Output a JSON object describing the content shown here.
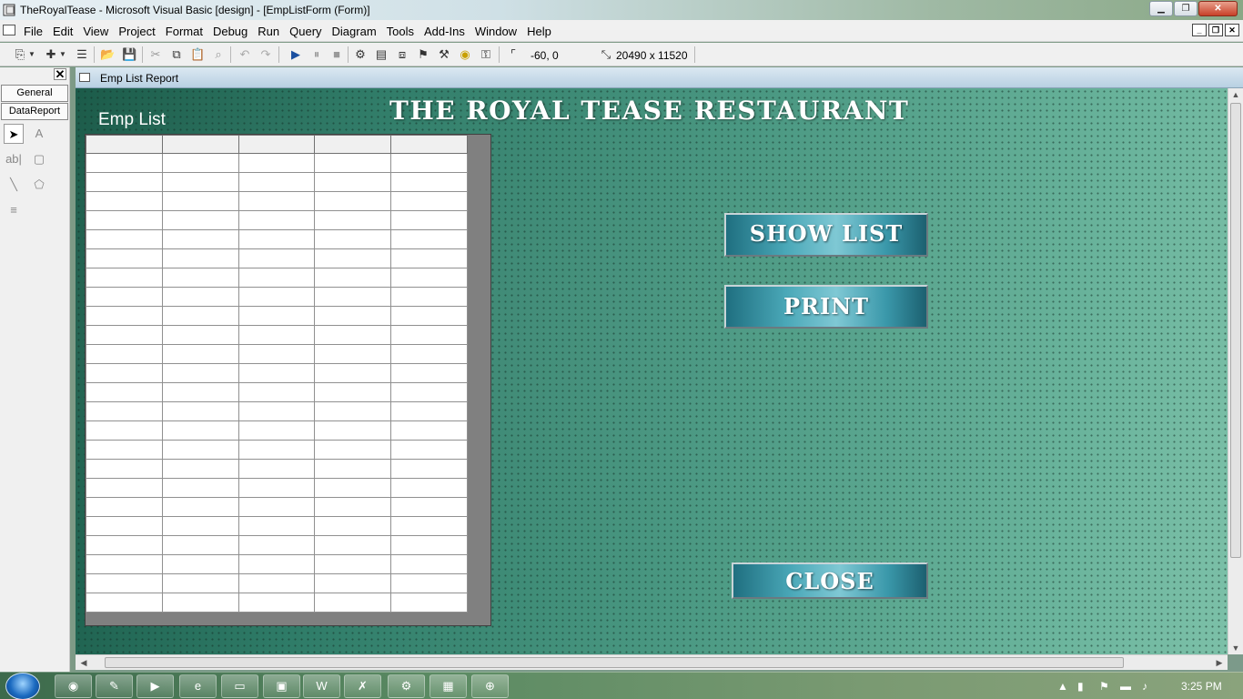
{
  "window": {
    "title": "TheRoyalTease - Microsoft Visual Basic [design] - [EmpListForm (Form)]"
  },
  "menubar": {
    "items": [
      "File",
      "Edit",
      "View",
      "Project",
      "Format",
      "Debug",
      "Run",
      "Query",
      "Diagram",
      "Tools",
      "Add-Ins",
      "Window",
      "Help"
    ]
  },
  "toolbar": {
    "position_readout": "-60, 0",
    "size_readout": "20490 x 11520"
  },
  "toolbox": {
    "tab_general": "General",
    "tab_datareport": "DataReport",
    "close_glyph": "✕"
  },
  "form": {
    "caption": "Emp List Report",
    "heading": "THE ROYAL TEASE RESTAURANT",
    "grid_label": "Emp List",
    "grid": {
      "columns": 5,
      "rows": 24
    },
    "buttons": {
      "show_list": "SHOW LIST",
      "print": "PRINT",
      "close": "CLOSE"
    }
  },
  "taskbar": {
    "clock": "3:25 PM"
  },
  "colors": {
    "form_background": "#3e8a78",
    "button_face": "#4aa8b8",
    "caption_bar": "#c8dcea"
  },
  "icons": {
    "app": "vb-app-icon",
    "start": "windows-start-icon",
    "taskbar_apps": [
      "chrome-icon",
      "paint-icon",
      "media-player-icon",
      "internet-explorer-icon",
      "explorer-folder-icon",
      "window-icon",
      "word-icon",
      "acrobat-icon",
      "vb6-icon",
      "paint-palette-icon",
      "system-icon"
    ]
  }
}
